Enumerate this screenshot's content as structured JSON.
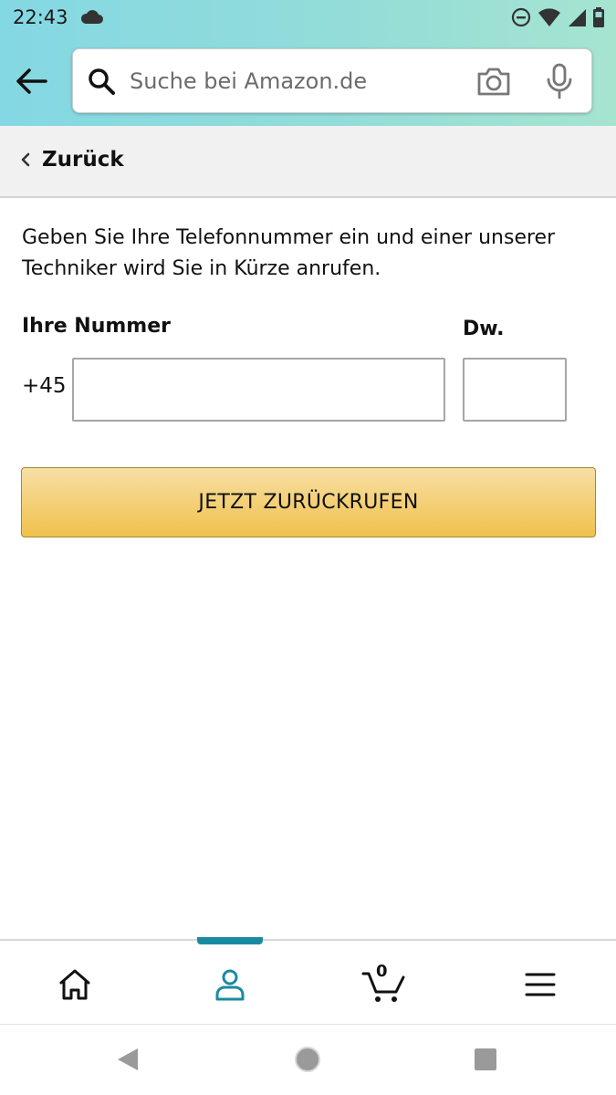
{
  "status_bar": {
    "time": "22:43",
    "icons": [
      "cloud-icon",
      "do-not-disturb-icon",
      "wifi-icon",
      "signal-icon",
      "battery-icon"
    ]
  },
  "header": {
    "search_placeholder": "Suche bei Amazon.de",
    "icons": [
      "back-arrow-icon",
      "search-icon",
      "camera-icon",
      "microphone-icon"
    ]
  },
  "backbar": {
    "label": "Zurück"
  },
  "main": {
    "intro": "Geben Sie Ihre Telefonnummer ein und einer unserer Techniker wird Sie in Kürze anrufen.",
    "number_label": "Ihre Nummer",
    "extension_label": "Dw.",
    "country_prefix": "+45",
    "number_value": "",
    "extension_value": "",
    "callback_button": "JETZT ZURÜCKRUFEN"
  },
  "bottom_nav": {
    "items": [
      "home-icon",
      "account-icon",
      "cart-icon",
      "menu-icon"
    ],
    "active": "account",
    "cart_count": "0"
  },
  "colors": {
    "header_gradient_start": "#84d8e3",
    "header_gradient_end": "#a6e4d0",
    "button_top": "#f7dfa5",
    "button_bottom": "#f0c14b",
    "active_nav": "#1a8aa0"
  }
}
